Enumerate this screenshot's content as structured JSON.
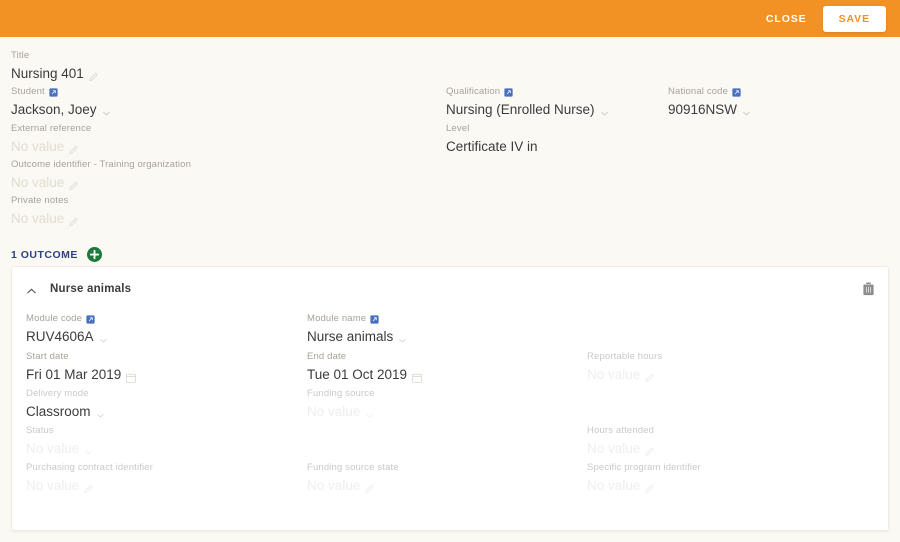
{
  "topbar": {
    "accent_color": "#f29225",
    "close_label": "CLOSE",
    "save_label": "SAVE"
  },
  "form": {
    "no_value": "No value",
    "fields": [
      {
        "label": "Title",
        "value": "Nursing 401",
        "icon": "",
        "affordance": "pencil",
        "empty": false
      },
      {
        "label": "Student",
        "value": "Jackson, Joey",
        "icon": "external-link",
        "affordance": "chevron",
        "empty": false
      },
      {
        "label": "Qualification",
        "value": "Nursing (Enrolled Nurse)",
        "icon": "external-link",
        "affordance": "chevron",
        "empty": false
      },
      {
        "label": "National code",
        "value": "90916NSW",
        "icon": "external-link",
        "affordance": "chevron",
        "empty": false
      },
      {
        "label": "External reference",
        "value": "No value",
        "icon": "",
        "affordance": "pencil",
        "empty": true
      },
      {
        "label": "Level",
        "value": "Certificate IV in",
        "icon": "",
        "affordance": "none",
        "empty": false
      },
      {
        "label": "Outcome identifier - Training organization",
        "value": "No value",
        "icon": "",
        "affordance": "pencil",
        "empty": true
      },
      {
        "label": "Private notes",
        "value": "No value",
        "icon": "",
        "affordance": "pencil",
        "empty": true
      }
    ]
  },
  "outcomes": {
    "count_label": "1 OUTCOME",
    "count_color": "#2f4180",
    "add_color": "#1e7a3c",
    "card": {
      "title": "Nurse animals",
      "fields": [
        {
          "label": "Module code",
          "value": "RUV4606A",
          "icon": "external-link",
          "affordance": "chevron",
          "empty": false
        },
        {
          "label": "Module name",
          "value": "Nurse animals",
          "icon": "external-link",
          "affordance": "chevron",
          "empty": false
        },
        {
          "label": "Start date",
          "value": "Fri 01 Mar 2019",
          "icon": "",
          "affordance": "calendar",
          "empty": false
        },
        {
          "label": "End date",
          "value": "Tue 01 Oct 2019",
          "icon": "",
          "affordance": "calendar",
          "empty": false
        },
        {
          "label": "Reportable hours",
          "value": "No value",
          "icon": "",
          "affordance": "pencil",
          "empty": true
        },
        {
          "label": "Delivery mode",
          "value": "Classroom",
          "icon": "",
          "affordance": "chevron",
          "empty": false
        },
        {
          "label": "Funding source",
          "value": "No value",
          "icon": "",
          "affordance": "chevron",
          "empty": true
        },
        {
          "label": "Status",
          "value": "No value",
          "icon": "",
          "affordance": "chevron",
          "empty": true
        },
        {
          "label": "Hours attended",
          "value": "No value",
          "icon": "",
          "affordance": "pencil",
          "empty": true
        },
        {
          "label": "Purchasing contract identifier",
          "value": "No value",
          "icon": "",
          "affordance": "pencil",
          "empty": true
        },
        {
          "label": "Funding source state",
          "value": "No value",
          "icon": "",
          "affordance": "pencil",
          "empty": true
        },
        {
          "label": "Specific program identifier",
          "value": "No value",
          "icon": "",
          "affordance": "pencil",
          "empty": true
        }
      ]
    }
  }
}
